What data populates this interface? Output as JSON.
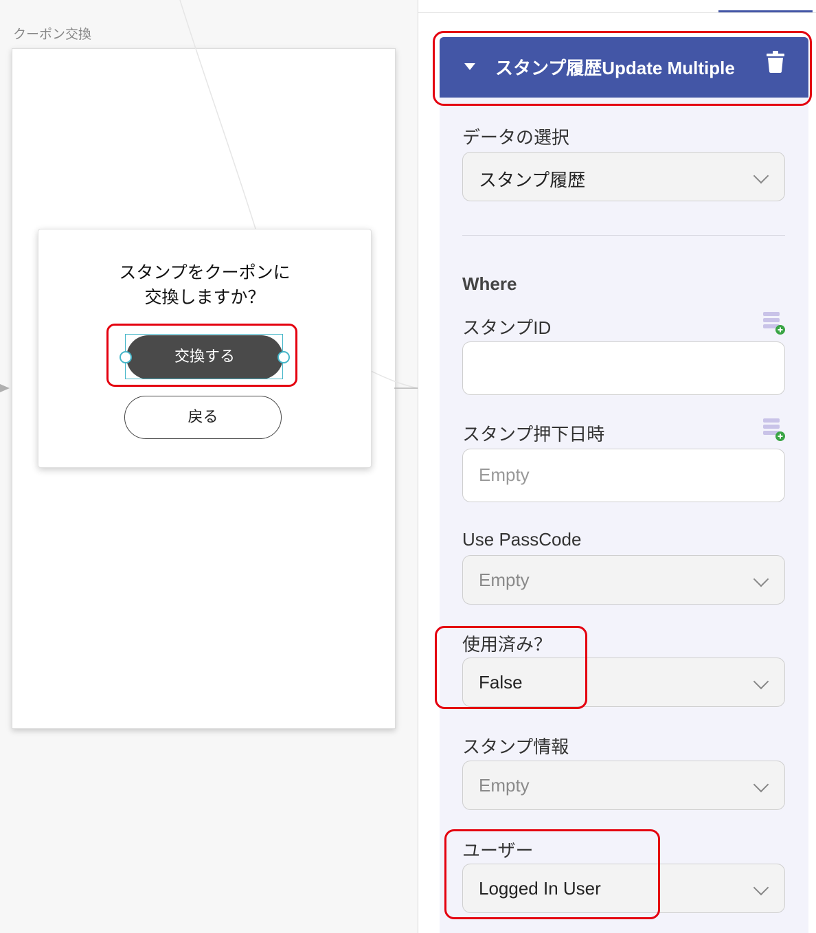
{
  "canvas": {
    "screen_label": "クーポン交換",
    "dialog": {
      "message_line1": "スタンプをクーポンに",
      "message_line2": "交換しますか？",
      "exchange_button": "交換する",
      "back_button": "戻る"
    }
  },
  "panel": {
    "action": {
      "title": "スタンプ履歴Update Multiple",
      "collapse_icon": "caret-down-icon",
      "delete_icon": "trash-icon"
    },
    "data_select": {
      "label": "データの選択",
      "value": "スタンプ履歴"
    },
    "where": {
      "heading": "Where",
      "fields": [
        {
          "label": "スタンプID",
          "type": "input",
          "value": "",
          "placeholder": ""
        },
        {
          "label": "スタンプ押下日時",
          "type": "input",
          "value": "",
          "placeholder": "Empty"
        },
        {
          "label": "Use PassCode",
          "type": "select",
          "value": "Empty"
        },
        {
          "label": "使用済み？",
          "type": "select",
          "value": "False"
        },
        {
          "label": "スタンプ情報",
          "type": "select",
          "value": "Empty"
        },
        {
          "label": "ユーザー",
          "type": "select",
          "value": "Logged In User"
        }
      ]
    }
  },
  "colors": {
    "accent": "#4356a6",
    "highlight": "#e4000f",
    "selection": "#45b6c9",
    "button_dark": "#4a4a4a"
  }
}
